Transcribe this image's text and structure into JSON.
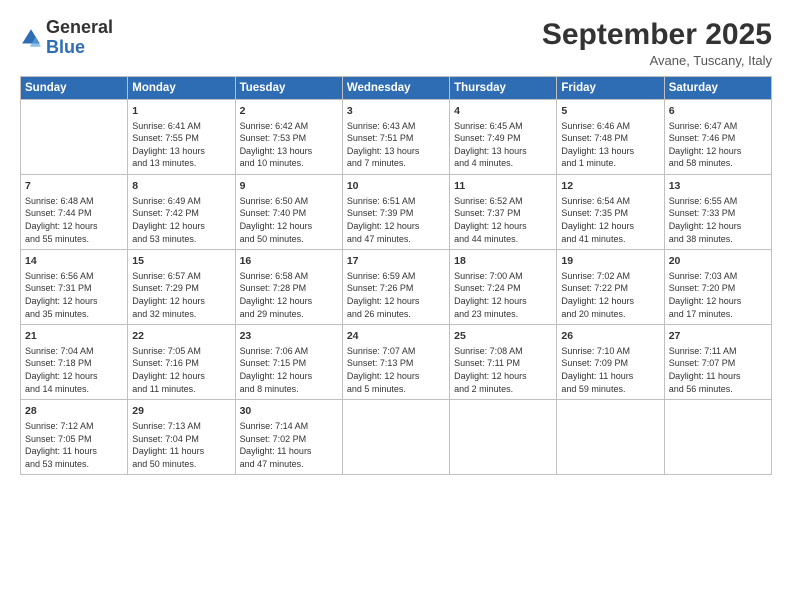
{
  "logo": {
    "line1": "General",
    "line2": "Blue"
  },
  "title": "September 2025",
  "subtitle": "Avane, Tuscany, Italy",
  "days": [
    "Sunday",
    "Monday",
    "Tuesday",
    "Wednesday",
    "Thursday",
    "Friday",
    "Saturday"
  ],
  "weeks": [
    [
      {
        "day": "",
        "text": ""
      },
      {
        "day": "1",
        "text": "Sunrise: 6:41 AM\nSunset: 7:55 PM\nDaylight: 13 hours\nand 13 minutes."
      },
      {
        "day": "2",
        "text": "Sunrise: 6:42 AM\nSunset: 7:53 PM\nDaylight: 13 hours\nand 10 minutes."
      },
      {
        "day": "3",
        "text": "Sunrise: 6:43 AM\nSunset: 7:51 PM\nDaylight: 13 hours\nand 7 minutes."
      },
      {
        "day": "4",
        "text": "Sunrise: 6:45 AM\nSunset: 7:49 PM\nDaylight: 13 hours\nand 4 minutes."
      },
      {
        "day": "5",
        "text": "Sunrise: 6:46 AM\nSunset: 7:48 PM\nDaylight: 13 hours\nand 1 minute."
      },
      {
        "day": "6",
        "text": "Sunrise: 6:47 AM\nSunset: 7:46 PM\nDaylight: 12 hours\nand 58 minutes."
      }
    ],
    [
      {
        "day": "7",
        "text": "Sunrise: 6:48 AM\nSunset: 7:44 PM\nDaylight: 12 hours\nand 55 minutes."
      },
      {
        "day": "8",
        "text": "Sunrise: 6:49 AM\nSunset: 7:42 PM\nDaylight: 12 hours\nand 53 minutes."
      },
      {
        "day": "9",
        "text": "Sunrise: 6:50 AM\nSunset: 7:40 PM\nDaylight: 12 hours\nand 50 minutes."
      },
      {
        "day": "10",
        "text": "Sunrise: 6:51 AM\nSunset: 7:39 PM\nDaylight: 12 hours\nand 47 minutes."
      },
      {
        "day": "11",
        "text": "Sunrise: 6:52 AM\nSunset: 7:37 PM\nDaylight: 12 hours\nand 44 minutes."
      },
      {
        "day": "12",
        "text": "Sunrise: 6:54 AM\nSunset: 7:35 PM\nDaylight: 12 hours\nand 41 minutes."
      },
      {
        "day": "13",
        "text": "Sunrise: 6:55 AM\nSunset: 7:33 PM\nDaylight: 12 hours\nand 38 minutes."
      }
    ],
    [
      {
        "day": "14",
        "text": "Sunrise: 6:56 AM\nSunset: 7:31 PM\nDaylight: 12 hours\nand 35 minutes."
      },
      {
        "day": "15",
        "text": "Sunrise: 6:57 AM\nSunset: 7:29 PM\nDaylight: 12 hours\nand 32 minutes."
      },
      {
        "day": "16",
        "text": "Sunrise: 6:58 AM\nSunset: 7:28 PM\nDaylight: 12 hours\nand 29 minutes."
      },
      {
        "day": "17",
        "text": "Sunrise: 6:59 AM\nSunset: 7:26 PM\nDaylight: 12 hours\nand 26 minutes."
      },
      {
        "day": "18",
        "text": "Sunrise: 7:00 AM\nSunset: 7:24 PM\nDaylight: 12 hours\nand 23 minutes."
      },
      {
        "day": "19",
        "text": "Sunrise: 7:02 AM\nSunset: 7:22 PM\nDaylight: 12 hours\nand 20 minutes."
      },
      {
        "day": "20",
        "text": "Sunrise: 7:03 AM\nSunset: 7:20 PM\nDaylight: 12 hours\nand 17 minutes."
      }
    ],
    [
      {
        "day": "21",
        "text": "Sunrise: 7:04 AM\nSunset: 7:18 PM\nDaylight: 12 hours\nand 14 minutes."
      },
      {
        "day": "22",
        "text": "Sunrise: 7:05 AM\nSunset: 7:16 PM\nDaylight: 12 hours\nand 11 minutes."
      },
      {
        "day": "23",
        "text": "Sunrise: 7:06 AM\nSunset: 7:15 PM\nDaylight: 12 hours\nand 8 minutes."
      },
      {
        "day": "24",
        "text": "Sunrise: 7:07 AM\nSunset: 7:13 PM\nDaylight: 12 hours\nand 5 minutes."
      },
      {
        "day": "25",
        "text": "Sunrise: 7:08 AM\nSunset: 7:11 PM\nDaylight: 12 hours\nand 2 minutes."
      },
      {
        "day": "26",
        "text": "Sunrise: 7:10 AM\nSunset: 7:09 PM\nDaylight: 11 hours\nand 59 minutes."
      },
      {
        "day": "27",
        "text": "Sunrise: 7:11 AM\nSunset: 7:07 PM\nDaylight: 11 hours\nand 56 minutes."
      }
    ],
    [
      {
        "day": "28",
        "text": "Sunrise: 7:12 AM\nSunset: 7:05 PM\nDaylight: 11 hours\nand 53 minutes."
      },
      {
        "day": "29",
        "text": "Sunrise: 7:13 AM\nSunset: 7:04 PM\nDaylight: 11 hours\nand 50 minutes."
      },
      {
        "day": "30",
        "text": "Sunrise: 7:14 AM\nSunset: 7:02 PM\nDaylight: 11 hours\nand 47 minutes."
      },
      {
        "day": "",
        "text": ""
      },
      {
        "day": "",
        "text": ""
      },
      {
        "day": "",
        "text": ""
      },
      {
        "day": "",
        "text": ""
      }
    ]
  ]
}
